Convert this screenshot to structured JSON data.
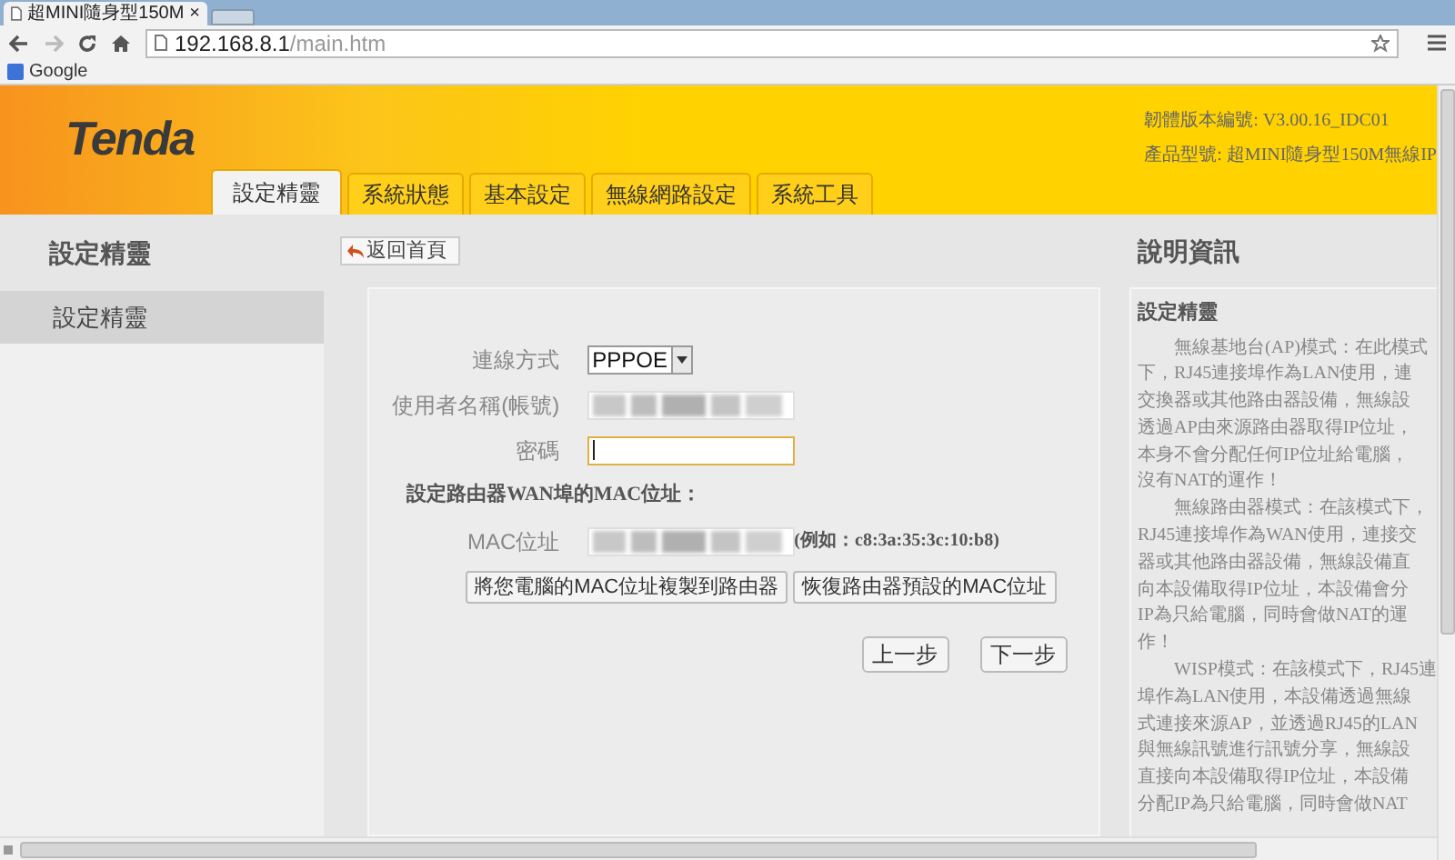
{
  "browser": {
    "tab": {
      "title": "超MINI隨身型150M",
      "close": "×"
    },
    "address": {
      "host": "192.168.8.1",
      "path": "/main.htm"
    },
    "bookmarks": [
      {
        "label": "Google"
      }
    ]
  },
  "header": {
    "logo": "Tenda",
    "firmware": "韌體版本編號: V3.00.16_IDC01",
    "model": "產品型號: 超MINI隨身型150M無線IP",
    "tabs": [
      {
        "label": "設定精靈",
        "selected": true
      },
      {
        "label": "系統狀態",
        "selected": false
      },
      {
        "label": "基本設定",
        "selected": false
      },
      {
        "label": "無線網路設定",
        "selected": false
      },
      {
        "label": "系統工具",
        "selected": false
      }
    ]
  },
  "sidebar": {
    "title": "設定精靈",
    "items": [
      {
        "label": "設定精靈",
        "selected": true
      }
    ]
  },
  "back_button": "返回首頁",
  "form": {
    "connection": {
      "label": "連線方式",
      "value": "PPPOE"
    },
    "username": {
      "label": "使用者名稱(帳號)",
      "redacted": true
    },
    "password": {
      "label": "密碼",
      "focused": true
    },
    "mac_heading": "設定路由器WAN埠的MAC位址：",
    "mac": {
      "label": "MAC位址",
      "redacted": true,
      "hint": "(例如：c8:3a:35:3c:10:b8)"
    },
    "mac_buttons": [
      "將您電腦的MAC位址複製到路由器",
      "恢復路由器預設的MAC位址"
    ],
    "nav_buttons": [
      "上一步",
      "下一步"
    ]
  },
  "help": {
    "title": "說明資訊",
    "heading": "設定精靈",
    "paragraphs": [
      [
        "無線基地台(AP)模式：在此模式",
        "下，RJ45連接埠作為LAN使用，連",
        "交換器或其他路由器設備，無線設",
        "透過AP由來源路由器取得IP位址，",
        "本身不會分配任何IP位址給電腦，",
        "沒有NAT的運作！"
      ],
      [
        "無線路由器模式：在該模式下，",
        "RJ45連接埠作為WAN使用，連接交",
        "器或其他路由器設備，無線設備直",
        "向本設備取得IP位址，本設備會分",
        "IP為只給電腦，同時會做NAT的運",
        "作！"
      ],
      [
        "WISP模式：在該模式下，RJ45連",
        "埠作為LAN使用，本設備透過無線",
        "式連接來源AP，並透過RJ45的LAN",
        "與無線訊號進行訊號分享，無線設",
        "直接向本設備取得IP位址，本設備",
        "分配IP為只給電腦，同時會做NAT"
      ]
    ]
  }
}
